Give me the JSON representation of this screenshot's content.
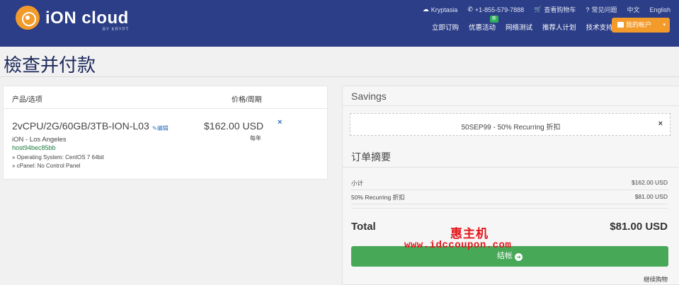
{
  "header": {
    "logo_text": "iON cloud",
    "logo_sub": "BY KRYPT",
    "toplinks": {
      "kryptasia": "Kryptasia",
      "phone": "+1-855-579-7888",
      "cart": "查看购物车",
      "faq": "常见问题",
      "lang_cn": "中文",
      "lang_en": "English"
    },
    "nav": [
      {
        "label": "立即订购"
      },
      {
        "label": "优惠活动",
        "badge": "新"
      },
      {
        "label": "网络测试"
      },
      {
        "label": "推荐人计划"
      },
      {
        "label": "技术支持"
      }
    ],
    "account_button": "我的帐户"
  },
  "page_title": "檢查并付款",
  "cart": {
    "col_product": "产品/选项",
    "col_price": "价格/周期",
    "item": {
      "name": "2vCPU/2G/60GB/3TB-ION-L03",
      "edit": "编辑",
      "group": "iON - Los Angeles",
      "hostname": "host94bec85bb",
      "option1": "» Operating System: CentOS 7 64bit",
      "option2": "» cPanel: No Control Panel",
      "price": "$162.00 USD",
      "cycle": "每年",
      "remove": "×"
    }
  },
  "summary": {
    "savings_title": "Savings",
    "promo_text": "50SEP99 - 50% Recurring 折扣",
    "promo_remove": "×",
    "title": "订单摘要",
    "rows": [
      {
        "label": "小计",
        "value": "$162.00 USD"
      },
      {
        "label": "50% Recurring 折扣",
        "value": "$81.00 USD"
      }
    ],
    "total_label": "Total",
    "total_value": "$81.00 USD",
    "checkout": "结帐",
    "continue": "继续购物"
  },
  "watermark": {
    "cn": "惠主机",
    "url": "www.idccoupon.com"
  },
  "colors": {
    "header_bg": "#2c3e87",
    "accent_orange": "#f39b2a",
    "checkout_green": "#47a857",
    "watermark_red": "#e3161b"
  }
}
